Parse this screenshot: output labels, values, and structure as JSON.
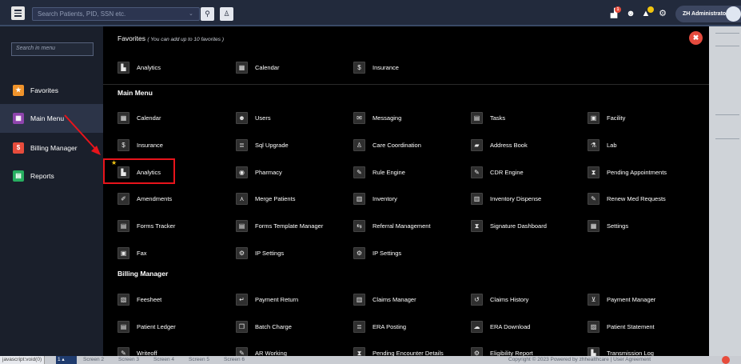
{
  "topbar": {
    "search_placeholder": "Search Patients, PID, SSN etc.",
    "user_name": "ZH Administrator",
    "badge_count": "1"
  },
  "sidebar": {
    "search_placeholder": "Search in menu",
    "items": [
      {
        "label": "Favorites",
        "color": "#f0932b",
        "glyph": "★"
      },
      {
        "label": "Main Menu",
        "color": "#8e44ad",
        "glyph": "▦"
      },
      {
        "label": "Billing Manager",
        "color": "#e74c3c",
        "glyph": "$"
      },
      {
        "label": "Reports",
        "color": "#27ae60",
        "glyph": "▤"
      }
    ]
  },
  "favorites": {
    "title": "Favorites",
    "note": "( You can add up to 10 favorites )",
    "items": [
      {
        "label": "Analytics",
        "icon": "chart-icon",
        "glyph": "▙"
      },
      {
        "label": "Calendar",
        "icon": "calendar-icon",
        "glyph": "▦"
      },
      {
        "label": "Insurance",
        "icon": "dollar-icon",
        "glyph": "$"
      }
    ]
  },
  "main_menu": {
    "title": "Main Menu",
    "rows": [
      [
        {
          "label": "Calendar",
          "icon": "calendar-icon",
          "glyph": "▦"
        },
        {
          "label": "Users",
          "icon": "users-icon",
          "glyph": "☻"
        },
        {
          "label": "Messaging",
          "icon": "envelope-icon",
          "glyph": "✉"
        },
        {
          "label": "Tasks",
          "icon": "tasks-icon",
          "glyph": "▤"
        },
        {
          "label": "Facility",
          "icon": "building-icon",
          "glyph": "▣"
        }
      ],
      [
        {
          "label": "Insurance",
          "icon": "dollar-icon",
          "glyph": "$"
        },
        {
          "label": "Sql Upgrade",
          "icon": "database-icon",
          "glyph": "≣"
        },
        {
          "label": "Care Coordination",
          "icon": "person-icon",
          "glyph": "♙"
        },
        {
          "label": "Address Book",
          "icon": "book-icon",
          "glyph": "▰"
        },
        {
          "label": "Lab",
          "icon": "flask-icon",
          "glyph": "⚗"
        }
      ],
      [
        {
          "label": "Analytics",
          "icon": "chart-icon",
          "glyph": "▙"
        },
        {
          "label": "Pharmacy",
          "icon": "camera-icon",
          "glyph": "◉"
        },
        {
          "label": "Rule Engine",
          "icon": "wrench-icon",
          "glyph": "✎"
        },
        {
          "label": "CDR Engine",
          "icon": "wrench-icon",
          "glyph": "✎"
        },
        {
          "label": "Pending Appointments",
          "icon": "hourglass-icon",
          "glyph": "⧗"
        }
      ],
      [
        {
          "label": "Amendments",
          "icon": "edit-icon",
          "glyph": "✐"
        },
        {
          "label": "Merge Patients",
          "icon": "merge-icon",
          "glyph": "⋏"
        },
        {
          "label": "Inventory",
          "icon": "box-icon",
          "glyph": "▥"
        },
        {
          "label": "Inventory Dispense",
          "icon": "box-icon",
          "glyph": "▥"
        },
        {
          "label": "Renew Med Requests",
          "icon": "pencil-icon",
          "glyph": "✎"
        }
      ],
      [
        {
          "label": "Forms Tracker",
          "icon": "form-icon",
          "glyph": "▤"
        },
        {
          "label": "Forms Template Manager",
          "icon": "form-icon",
          "glyph": "▤"
        },
        {
          "label": "Referral Management",
          "icon": "referral-icon",
          "glyph": "⇆"
        },
        {
          "label": "Signature Dashboard",
          "icon": "hourglass-icon",
          "glyph": "⧗"
        },
        {
          "label": "Settings",
          "icon": "settings-icon",
          "glyph": "▦"
        }
      ],
      [
        {
          "label": "Fax",
          "icon": "fax-icon",
          "glyph": "▣"
        },
        {
          "label": "IP Settings",
          "icon": "gear-icon",
          "glyph": "⚙"
        },
        {
          "label": "IP Settings",
          "icon": "gear-icon",
          "glyph": "⚙"
        }
      ]
    ]
  },
  "billing_manager": {
    "title": "Billing Manager",
    "rows": [
      [
        {
          "label": "Feesheet",
          "icon": "document-icon",
          "glyph": "▧"
        },
        {
          "label": "Payment Return",
          "icon": "return-icon",
          "glyph": "↵"
        },
        {
          "label": "Claims Manager",
          "icon": "columns-icon",
          "glyph": "▥"
        },
        {
          "label": "Claims History",
          "icon": "history-icon",
          "glyph": "↺"
        },
        {
          "label": "Payment Manager",
          "icon": "cart-icon",
          "glyph": "⊻"
        }
      ],
      [
        {
          "label": "Patient Ledger",
          "icon": "ledger-icon",
          "glyph": "▤"
        },
        {
          "label": "Batch Charge",
          "icon": "copy-icon",
          "glyph": "❐"
        },
        {
          "label": "ERA Posting",
          "icon": "list-icon",
          "glyph": "≣"
        },
        {
          "label": "ERA Download",
          "icon": "cloud-download-icon",
          "glyph": "☁"
        },
        {
          "label": "Patient Statement",
          "icon": "statement-icon",
          "glyph": "▨"
        }
      ],
      [
        {
          "label": "Writeoff",
          "icon": "pencil-icon",
          "glyph": "✎"
        },
        {
          "label": "AR Working",
          "icon": "wrench-icon",
          "glyph": "✎"
        },
        {
          "label": "Pending Encounter Details",
          "icon": "hourglass-icon",
          "glyph": "⧗"
        },
        {
          "label": "Eligibility Report",
          "icon": "gear-icon",
          "glyph": "⚙"
        },
        {
          "label": "Transmission Log",
          "icon": "chart-icon",
          "glyph": "▙"
        }
      ]
    ]
  },
  "bottom_bar": {
    "status_url": "javascript:void(0)",
    "screens": [
      "Screen 2",
      "Screen 3",
      "Screen 4",
      "Screen 5",
      "Screen 6"
    ],
    "copyright": "Copyright © 2023 Powered by zhhealthcare | User Agreement"
  }
}
